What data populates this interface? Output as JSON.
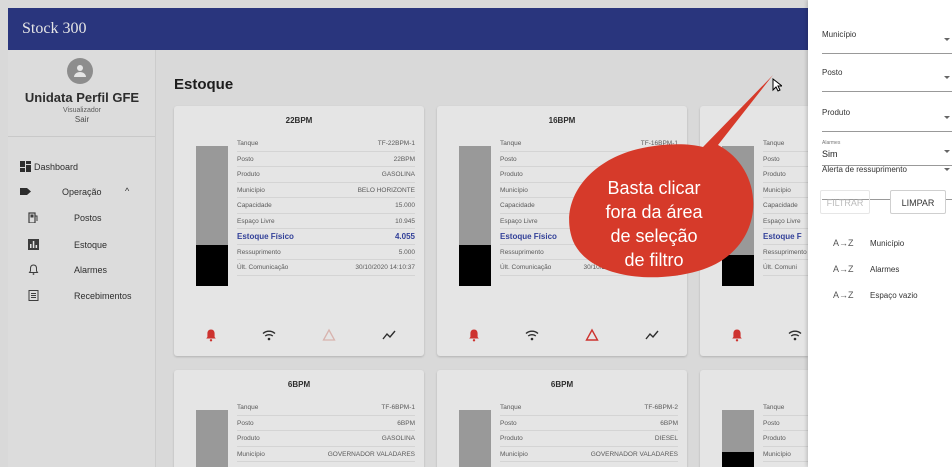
{
  "app": {
    "title": "Stock 300"
  },
  "sidebar": {
    "profile_name": "Unidata Perfil GFE",
    "profile_role": "Visualizador",
    "exit_label": "Sair",
    "items": [
      {
        "label": "Dashboard",
        "icon": "dashboard-icon"
      },
      {
        "label": "Operação",
        "icon": "label-icon",
        "expanded_indicator": "^"
      },
      {
        "label": "Postos",
        "icon": "fuel-station-icon"
      },
      {
        "label": "Estoque",
        "icon": "bar-chart-icon"
      },
      {
        "label": "Alarmes",
        "icon": "bell-icon"
      },
      {
        "label": "Recebimentos",
        "icon": "receipt-icon"
      }
    ]
  },
  "main": {
    "title": "Estoque",
    "cards": [
      {
        "title": "22BPM",
        "level": 0.29,
        "rows": [
          {
            "k": "Tanque",
            "v": "TF-22BPM-1"
          },
          {
            "k": "Posto",
            "v": "22BPM"
          },
          {
            "k": "Produto",
            "v": "GASOLINA"
          },
          {
            "k": "Município",
            "v": "BELO HORIZONTE"
          },
          {
            "k": "Capacidade",
            "v": "15.000"
          },
          {
            "k": "Espaço Livre",
            "v": "10.945"
          },
          {
            "k": "Estoque Físico",
            "v": "4.055"
          },
          {
            "k": "Ressuprimento",
            "v": "5.000"
          },
          {
            "k": "Últ. Comunicação",
            "v": "30/10/2020 14:10:37"
          }
        ]
      },
      {
        "title": "16BPM",
        "level": 0.29,
        "rows": [
          {
            "k": "Tanque",
            "v": "TF-16BPM-1"
          },
          {
            "k": "Posto",
            "v": ""
          },
          {
            "k": "Produto",
            "v": ""
          },
          {
            "k": "Município",
            "v": ""
          },
          {
            "k": "Capacidade",
            "v": ""
          },
          {
            "k": "Espaço Livre",
            "v": ""
          },
          {
            "k": "Estoque Físico",
            "v": ""
          },
          {
            "k": "Ressuprimento",
            "v": ""
          },
          {
            "k": "Últ. Comunicação",
            "v": "30/10/2020"
          }
        ]
      },
      {
        "title": "",
        "level": 0.22,
        "rows": [
          {
            "k": "Tanque",
            "v": ""
          },
          {
            "k": "Posto",
            "v": ""
          },
          {
            "k": "Produto",
            "v": ""
          },
          {
            "k": "Município",
            "v": ""
          },
          {
            "k": "Capacidade",
            "v": ""
          },
          {
            "k": "Espaço Livre",
            "v": ""
          },
          {
            "k": "Estoque F",
            "v": ""
          },
          {
            "k": "Ressuprimento",
            "v": ""
          },
          {
            "k": "Últ. Comuni",
            "v": ""
          }
        ]
      },
      {
        "title": "6BPM",
        "rows": [
          {
            "k": "Tanque",
            "v": "TF-6BPM-1"
          },
          {
            "k": "Posto",
            "v": "6BPM"
          },
          {
            "k": "Produto",
            "v": "GASOLINA"
          },
          {
            "k": "Município",
            "v": "GOVERNADOR VALADARES"
          }
        ]
      },
      {
        "title": "6BPM",
        "rows": [
          {
            "k": "Tanque",
            "v": "TF-6BPM-2"
          },
          {
            "k": "Posto",
            "v": "6BPM"
          },
          {
            "k": "Produto",
            "v": "DIESEL"
          },
          {
            "k": "Município",
            "v": "GOVERNADOR VALADARES"
          }
        ]
      },
      {
        "title": "",
        "rows": [
          {
            "k": "Tanque",
            "v": ""
          },
          {
            "k": "Posto",
            "v": ""
          },
          {
            "k": "Produto",
            "v": ""
          },
          {
            "k": "Município",
            "v": ""
          }
        ]
      }
    ]
  },
  "filters": {
    "municipio": {
      "label": "Município"
    },
    "posto": {
      "label": "Posto"
    },
    "produto": {
      "label": "Produto"
    },
    "alarmes": {
      "label": "Alarmes",
      "value": "Sim"
    },
    "alerta": {
      "label": "Alerta de ressuprimento"
    },
    "filter_button": "FILTRAR",
    "clear_button": "LIMPAR",
    "sort_items": [
      "Município",
      "Alarmes",
      "Espaço vazio"
    ],
    "sort_icon": "A→Z"
  },
  "callout": {
    "text_lines": [
      "Basta clicar",
      "fora da área",
      "de seleção",
      "de filtro"
    ]
  },
  "colors": {
    "topbar": "#2e3c8c",
    "callout": "#d63a2a",
    "highlight": "#3949ab",
    "alarm": "#e53935"
  }
}
